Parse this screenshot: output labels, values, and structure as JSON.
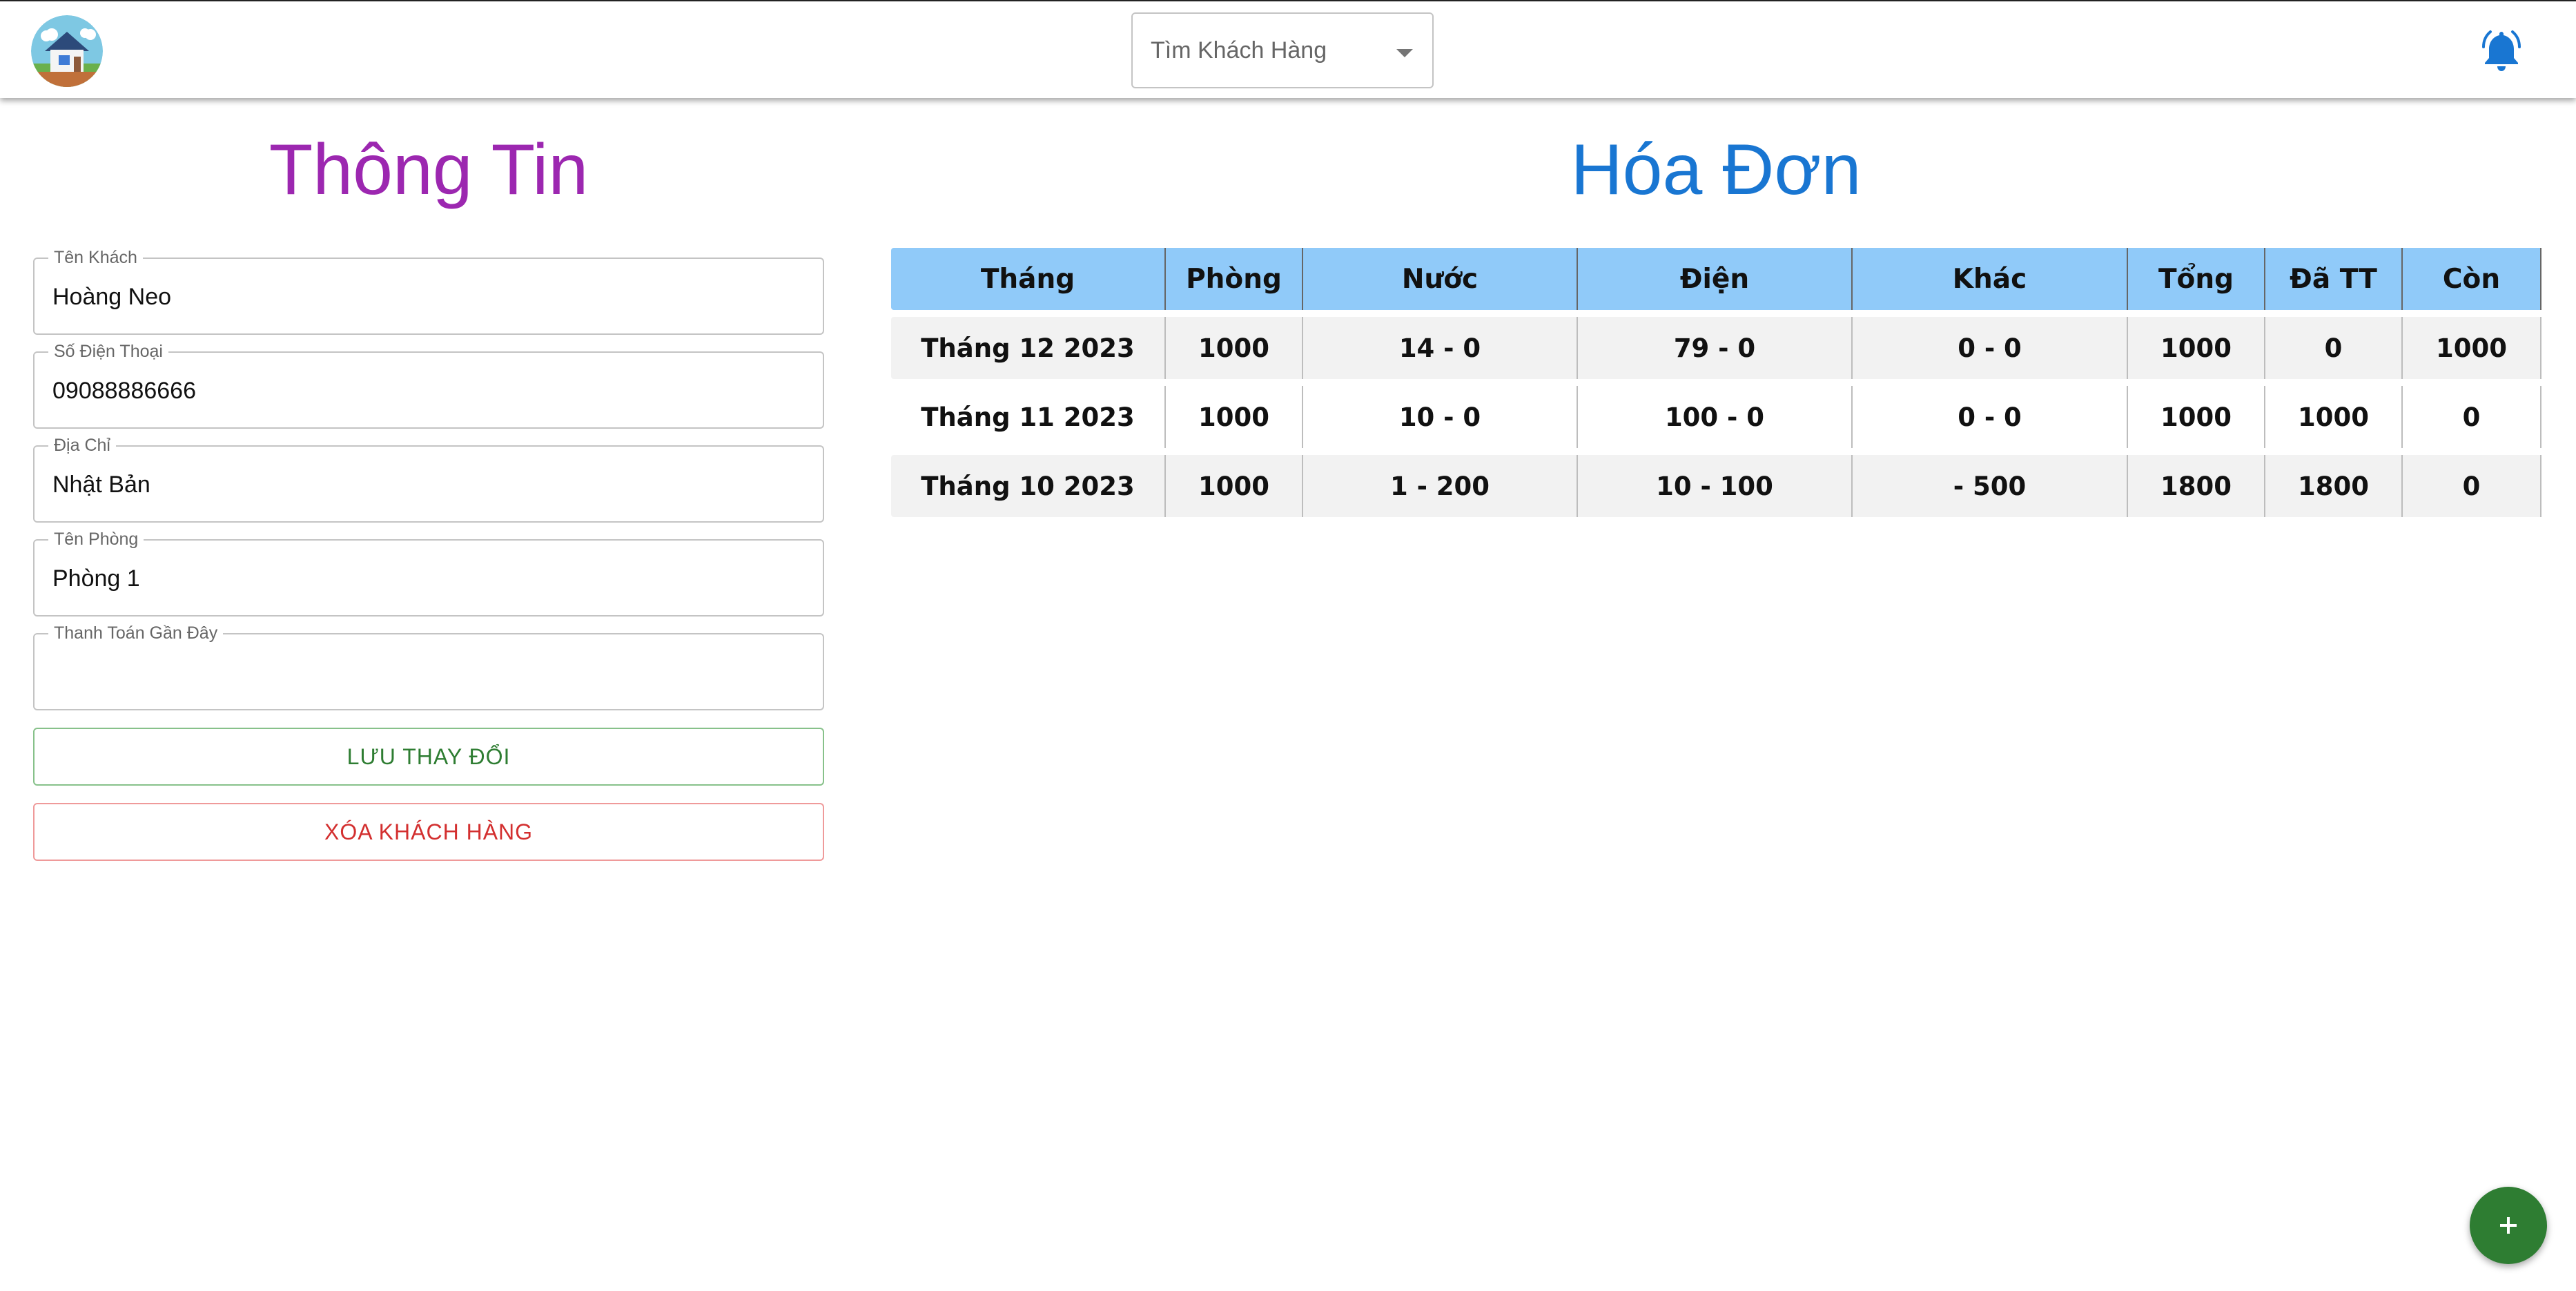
{
  "header": {
    "logo_icon": "house-logo-icon",
    "search": {
      "value": "Tìm Khách Hàng",
      "icon": "dropdown-caret-icon"
    },
    "notification_icon": "bell-icon",
    "accent_color": "#1976d2"
  },
  "info_panel": {
    "title": "Thông Tin",
    "title_color": "#9c27b0",
    "fields": [
      {
        "label": "Tên Khách",
        "value": "Hoàng Neo"
      },
      {
        "label": "Số Điện Thoại",
        "value": "09088886666"
      },
      {
        "label": "Địa Chỉ",
        "value": "Nhật Bản"
      },
      {
        "label": "Tên Phòng",
        "value": "Phòng 1"
      },
      {
        "label": "Thanh Toán Gần Đây",
        "value": ""
      }
    ],
    "save_button": "LƯU THAY ĐỔI",
    "delete_button": "XÓA KHÁCH HÀNG",
    "save_color": "#2e7d32",
    "delete_color": "#d32f2f"
  },
  "invoice_panel": {
    "title": "Hóa Đơn",
    "title_color": "#1976d2",
    "header_bg": "#90caf9",
    "columns": [
      "Tháng",
      "Phòng",
      "Nước",
      "Điện",
      "Khác",
      "Tổng",
      "Đã TT",
      "Còn"
    ],
    "rows": [
      [
        "Tháng 12 2023",
        "1000",
        "14 - 0",
        "79 - 0",
        "0 - 0",
        "1000",
        "0",
        "1000"
      ],
      [
        "Tháng 11 2023",
        "1000",
        "10 - 0",
        "100 - 0",
        "0 - 0",
        "1000",
        "1000",
        "0"
      ],
      [
        "Tháng 10 2023",
        "1000",
        "1 - 200",
        "10 - 100",
        "- 500",
        "1800",
        "1800",
        "0"
      ]
    ]
  },
  "fab": {
    "icon": "plus-icon",
    "color": "#2e7d32"
  }
}
